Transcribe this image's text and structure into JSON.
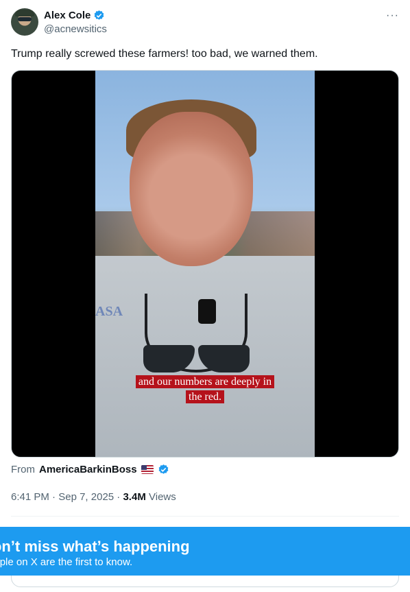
{
  "author": {
    "display_name": "Alex Cole",
    "handle": "@acnewsitics",
    "verified_icon": "verified-badge-icon",
    "more_label": "···"
  },
  "tweet": {
    "text": "Trump really screwed these farmers! too bad, we warned them."
  },
  "media": {
    "caption_line1": "and our numbers are deeply in",
    "caption_line2": "the red.",
    "shirt_logo": "ASA"
  },
  "attribution": {
    "from_label": "From",
    "account": "AmericaBarkinBoss",
    "flag_icon": "us-flag-icon"
  },
  "meta": {
    "time": "6:41 PM",
    "date": "Sep 7, 2025",
    "separator": "·",
    "views_count": "3.4M",
    "views_label": "Views"
  },
  "banner": {
    "title": "Don’t miss what’s happening",
    "subtitle": "People on X are the first to know."
  },
  "colors": {
    "accent": "#1d9bf0",
    "secondary_text": "#536471",
    "caption_bg": "#b5121b"
  }
}
